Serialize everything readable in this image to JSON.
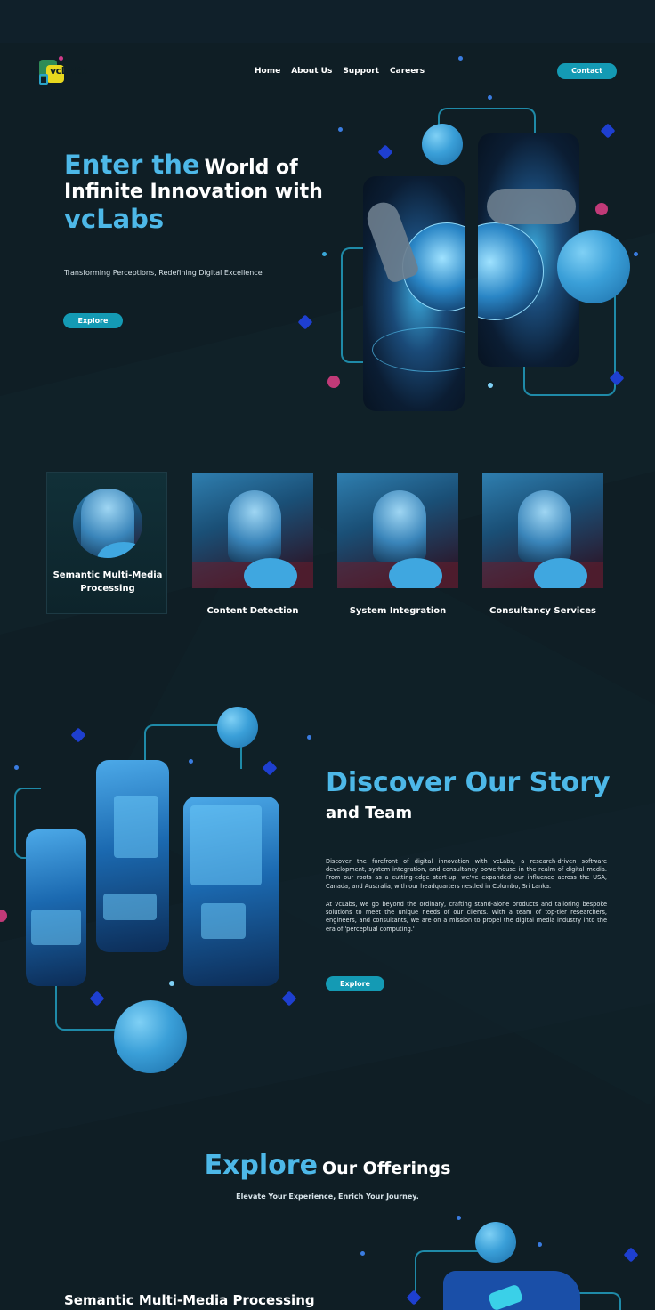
{
  "logo": {
    "text": "vcLABs"
  },
  "nav": {
    "items": [
      "Home",
      "About Us",
      "Support",
      "Careers"
    ],
    "contact_label": "Contact"
  },
  "hero": {
    "title_accent": "Enter the",
    "title_line1_rest": "World of",
    "title_line2": "Infinite Innovation with",
    "title_accent2": "vcLabs",
    "subtitle": "Transforming Perceptions, Redefining Digital Excellence",
    "cta_label": "Explore"
  },
  "services": [
    {
      "label": "Semantic Multi-Media Processing"
    },
    {
      "label": "Content Detection"
    },
    {
      "label": "System Integration"
    },
    {
      "label": "Consultancy Services"
    }
  ],
  "story": {
    "title_accent": "Discover Our Story",
    "title_white": "and Team",
    "paragraph1": "Discover the forefront of digital innovation with vcLabs, a research-driven software development, system integration, and consultancy powerhouse in the realm of digital media. From our roots as a cutting-edge start-up, we've expanded our influence across the USA, Canada, and Australia, with our headquarters nestled in Colombo, Sri Lanka.",
    "paragraph2": "At vcLabs, we go beyond the ordinary, crafting stand-alone products and tailoring bespoke solutions to meet the unique needs of our clients. With a team of top-tier researchers, engineers, and consultants, we are on a mission to propel the digital media industry into the era of 'perceptual computing.'",
    "cta_label": "Explore"
  },
  "offerings": {
    "title_accent": "Explore",
    "title_white": "Our Offerings",
    "subtitle": "Elevate Your Experience, Enrich Your Journey.",
    "first_item": "Semantic Multi-Media Processing"
  },
  "colors": {
    "accent": "#4db8e8",
    "button": "#149ab4",
    "background": "#0f1e25"
  }
}
